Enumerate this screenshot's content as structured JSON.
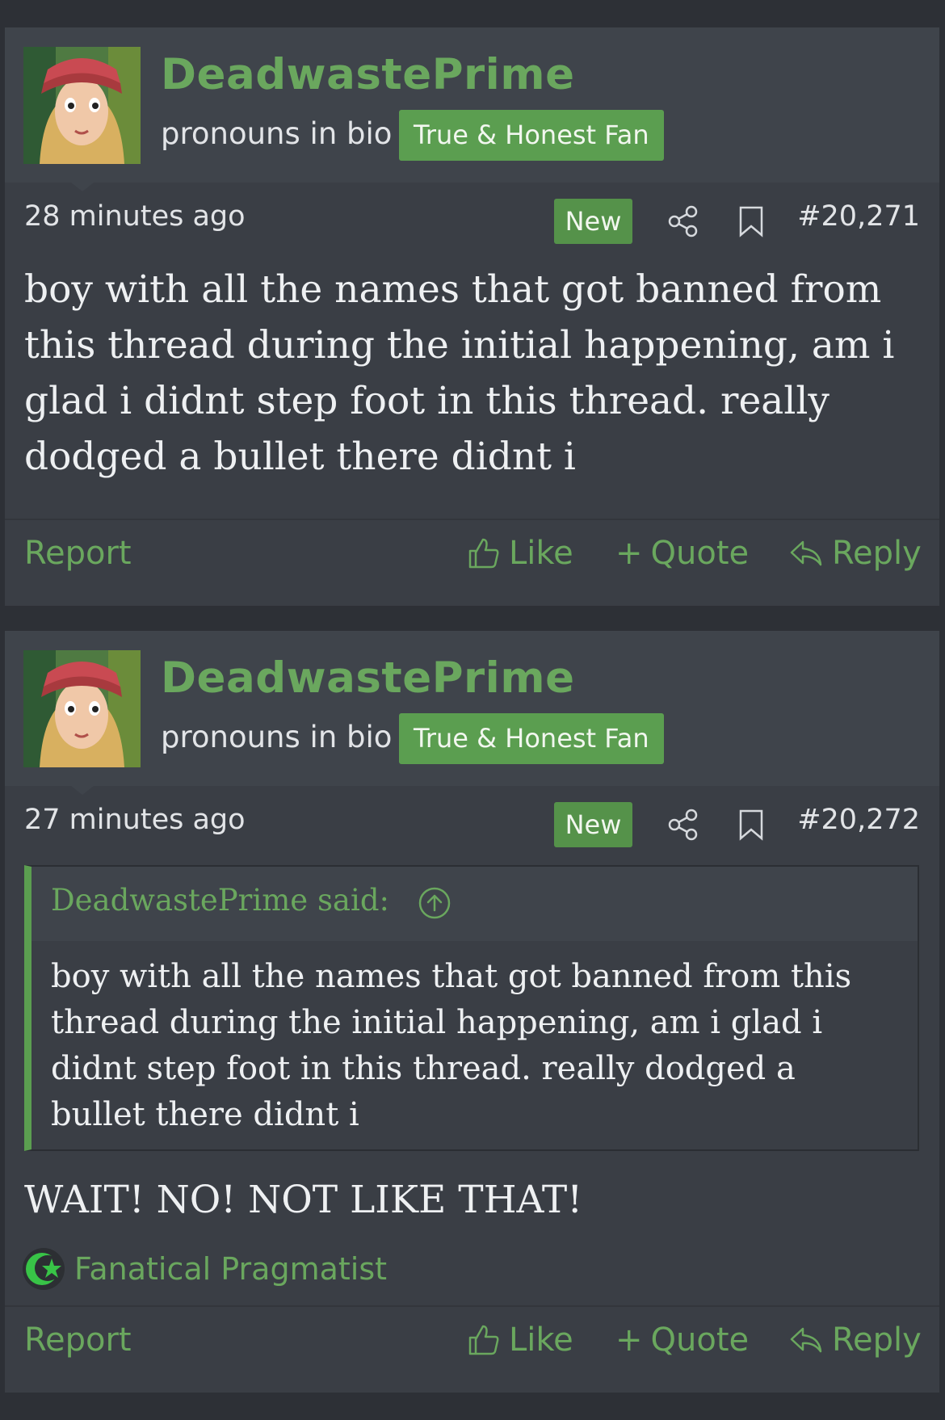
{
  "posts": [
    {
      "author": "DeadwastePrime",
      "user_title": "pronouns in bio",
      "user_badge": "True & Honest Fan",
      "timestamp": "28 minutes ago",
      "new_label": "New",
      "post_number": "#20,271",
      "body": "boy with all the names that got banned from this thread during the initial happening, am i glad i didnt step foot in this thread. really dodged a bullet there didnt i",
      "actions": {
        "report": "Report",
        "like": "Like",
        "quote": "Quote",
        "reply": "Reply"
      }
    },
    {
      "author": "DeadwastePrime",
      "user_title": "pronouns in bio",
      "user_badge": "True & Honest Fan",
      "timestamp": "27 minutes ago",
      "new_label": "New",
      "post_number": "#20,272",
      "quote": {
        "attribution": "DeadwastePrime said:",
        "text": "boy with all the names that got banned from this thread during the initial happening, am i glad i didnt step foot in this thread. really dodged a bullet there didnt i"
      },
      "body": "WAIT! NO! NOT LIKE THAT!",
      "reaction_label": "Fanatical Pragmatist",
      "actions": {
        "report": "Report",
        "like": "Like",
        "quote": "Quote",
        "reply": "Reply"
      }
    }
  ],
  "colors": {
    "accent": "#6aa75e",
    "badge": "#5b9e50",
    "page_bg": "#2d3036",
    "post_bg": "#3a3e45"
  },
  "icons": [
    "share-icon",
    "bookmark-icon",
    "thumbs-up-icon",
    "plus-icon",
    "reply-arrow-icon",
    "quote-up-arrow-icon",
    "star-crescent-icon"
  ]
}
